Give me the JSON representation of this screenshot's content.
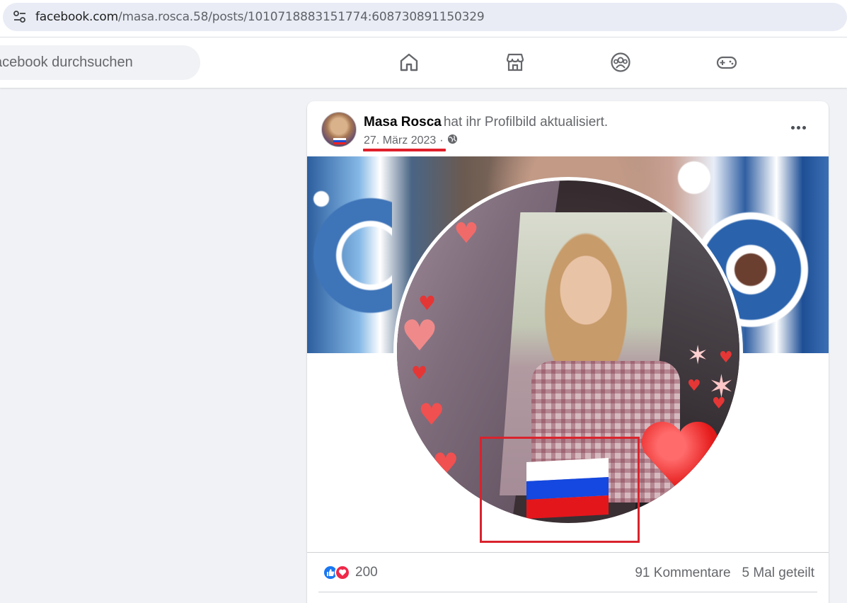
{
  "browser": {
    "url_main": "facebook.com",
    "url_path": "/masa.rosca.58/posts/1010718883151774:608730891150329",
    "site_settings_icon": "tune-icon"
  },
  "nav": {
    "search_placeholder": "acebook durchsuchen",
    "icons": [
      "home-icon",
      "marketplace-icon",
      "groups-icon",
      "gaming-icon"
    ]
  },
  "post": {
    "author": "Masa Rosca",
    "action": "hat ihr Profilbild aktualisiert.",
    "date": "27. März 2023",
    "separator": "·",
    "privacy_icon": "globe-icon",
    "more_icon": "more-dots-icon",
    "image_flag": "Russian flag",
    "annotation_color": "#d9232d",
    "reaction_count": "200",
    "comments": "91 Kommentare",
    "shares": "5 Mal geteilt"
  },
  "colors": {
    "fb_blue": "#1877f2",
    "love_red": "#f02849",
    "secondary_text": "#65676b"
  }
}
